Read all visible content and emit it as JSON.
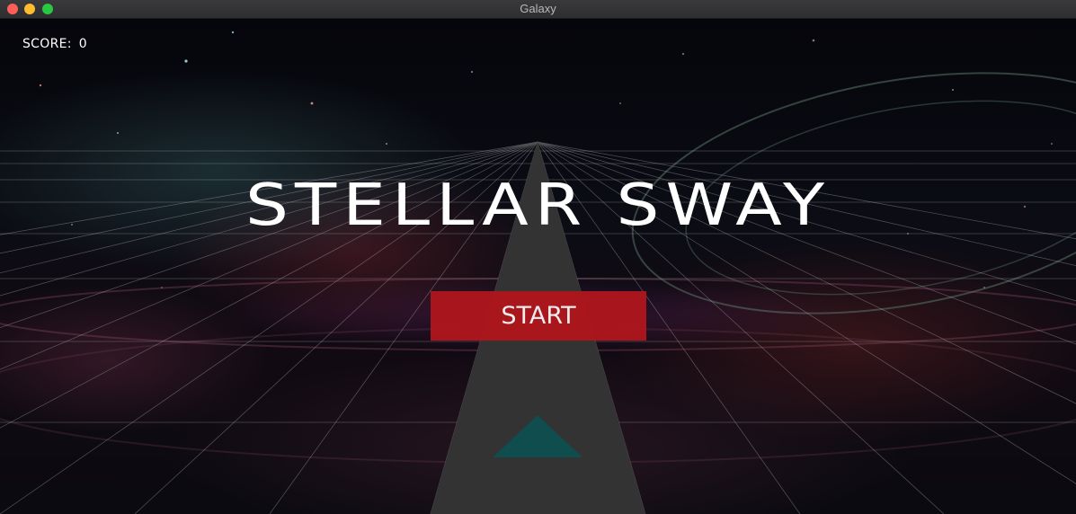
{
  "window": {
    "title": "Galaxy"
  },
  "hud": {
    "score_label": "SCORE:",
    "score_value": "0"
  },
  "menu": {
    "title": "STELLAR SWAY",
    "start_label": "START"
  },
  "colors": {
    "start_button": "#ae161d",
    "track": "#333333",
    "ship": "#0f4d4f",
    "grid_lines": "#c8c8c8",
    "traffic_close": "#ff5f57",
    "traffic_minimize": "#febc2e",
    "traffic_maximize": "#28c840"
  }
}
